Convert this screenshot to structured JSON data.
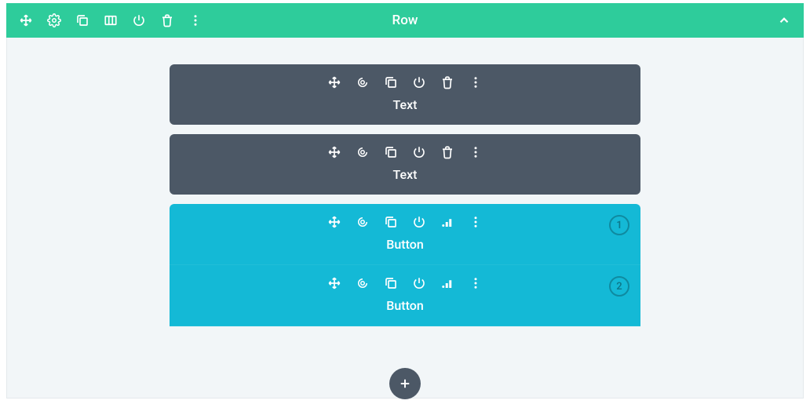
{
  "row": {
    "title": "Row",
    "icons": [
      "move",
      "gear",
      "duplicate",
      "columns",
      "power",
      "trash",
      "more"
    ],
    "collapse_icon": "chevron-up"
  },
  "modules": [
    {
      "type": "text",
      "label": "Text",
      "icons": [
        "move",
        "gear",
        "duplicate",
        "power",
        "trash",
        "more"
      ]
    },
    {
      "type": "text",
      "label": "Text",
      "icons": [
        "move",
        "gear",
        "duplicate",
        "power",
        "trash",
        "more"
      ]
    },
    {
      "type": "button",
      "label": "Button",
      "icons": [
        "move",
        "gear",
        "duplicate",
        "power",
        "stats",
        "more"
      ],
      "ab_variant": "1"
    },
    {
      "type": "button",
      "label": "Button",
      "icons": [
        "move",
        "gear",
        "duplicate",
        "power",
        "stats",
        "more"
      ],
      "ab_variant": "2"
    }
  ],
  "add_label": "+"
}
